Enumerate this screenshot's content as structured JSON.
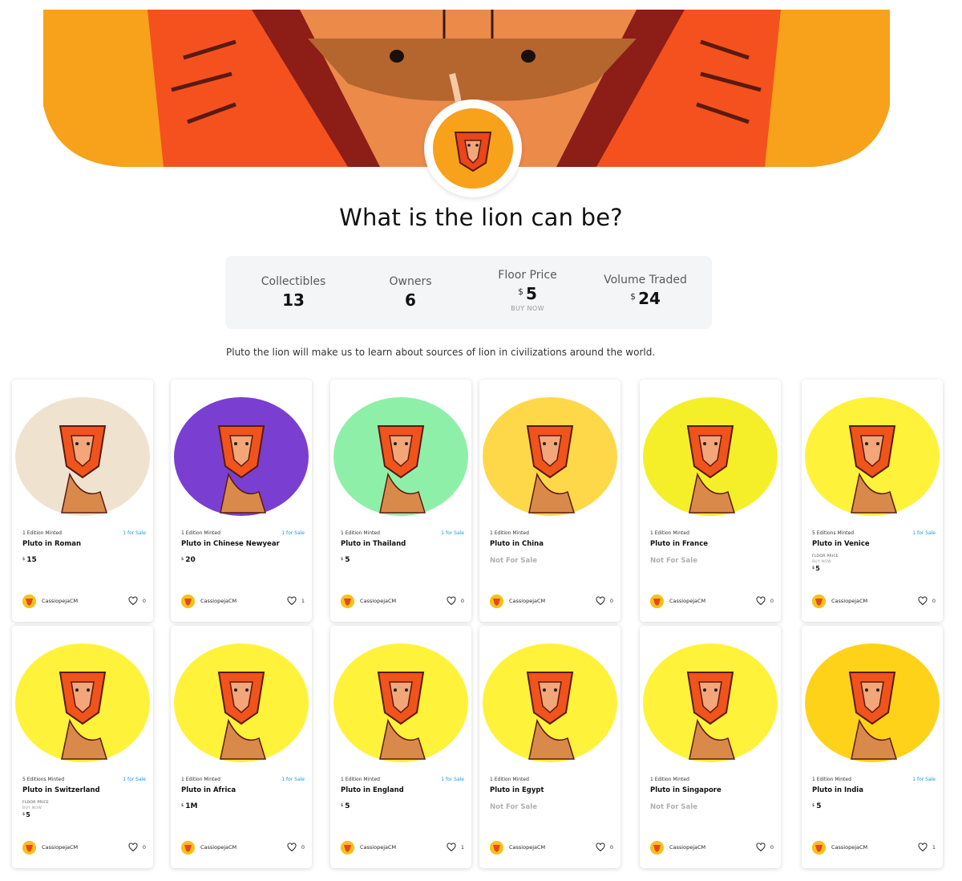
{
  "title": "What is the lion can be?",
  "stats": {
    "collectibles_label": "Collectibles",
    "collectibles_value": "13",
    "owners_label": "Owners",
    "owners_value": "6",
    "floor_label": "Floor Price",
    "floor_currency": "$",
    "floor_value": "5",
    "floor_action": "BUY NOW",
    "volume_label": "Volume Traded",
    "volume_currency": "$",
    "volume_value": "24"
  },
  "description": "Pluto the lion will make us to learn about sources of lion in civilizations around the world.",
  "cards": [
    {
      "editions": "1 Edition Minted",
      "sale": "1 for Sale",
      "name": "Pluto in Roman",
      "currency": "$",
      "price": "15",
      "status": "",
      "owner": "CassiopejaCM",
      "likes": "0",
      "art_bg": "#efe3d0"
    },
    {
      "editions": "1 Edition Minted",
      "sale": "1 for Sale",
      "name": "Pluto in Chinese Newyear",
      "currency": "$",
      "price": "20",
      "status": "",
      "owner": "CassiopejaCM",
      "likes": "1",
      "art_bg": "#7a3fd1"
    },
    {
      "editions": "1 Edition Minted",
      "sale": "1 for Sale",
      "name": "Pluto in Thailand",
      "currency": "$",
      "price": "5",
      "status": "",
      "owner": "CassiopejaCM",
      "likes": "0",
      "art_bg": "#8ef0a8"
    },
    {
      "editions": "1 Edition Minted",
      "sale": "",
      "name": "Pluto in China",
      "currency": "",
      "price": "",
      "status": "Not For Sale",
      "owner": "CassiopejaCM",
      "likes": "0",
      "art_bg": "#ffd84a"
    },
    {
      "editions": "1 Edition Minted",
      "sale": "",
      "name": "Pluto in France",
      "currency": "",
      "price": "",
      "status": "Not For Sale",
      "owner": "CassiopejaCM",
      "likes": "0",
      "art_bg": "#f5ef2a"
    },
    {
      "editions": "5 Editions Minted",
      "sale": "1 for Sale",
      "name": "Pluto in Venice",
      "currency": "$",
      "price": "5",
      "status": "",
      "floor_label": "FLOOR PRICE",
      "floor_action": "BUY NOW",
      "owner": "CassiopejaCM",
      "likes": "0",
      "art_bg": "#fff23a"
    },
    {
      "editions": "5 Editions Minted",
      "sale": "1 for Sale",
      "name": "Pluto in Switzerland",
      "currency": "$",
      "price": "5",
      "status": "",
      "floor_label": "FLOOR PRICE",
      "floor_action": "BUY NOW",
      "owner": "CassiopejaCM",
      "likes": "0",
      "art_bg": "#fff23a"
    },
    {
      "editions": "1 Edition Minted",
      "sale": "1 for Sale",
      "name": "Pluto in Africa",
      "currency": "$",
      "price": "1M",
      "status": "",
      "owner": "CassiopejaCM",
      "likes": "0",
      "art_bg": "#fff23a"
    },
    {
      "editions": "1 Edition Minted",
      "sale": "1 for Sale",
      "name": "Pluto in England",
      "currency": "$",
      "price": "5",
      "status": "",
      "owner": "CassiopejaCM",
      "likes": "1",
      "art_bg": "#fff23a"
    },
    {
      "editions": "1 Edition Minted",
      "sale": "",
      "name": "Pluto in Egypt",
      "currency": "",
      "price": "",
      "status": "Not For Sale",
      "owner": "CassiopejaCM",
      "likes": "0",
      "art_bg": "#fff23a"
    },
    {
      "editions": "1 Edition Minted",
      "sale": "",
      "name": "Pluto in Singapore",
      "currency": "",
      "price": "",
      "status": "Not For Sale",
      "owner": "CassiopejaCM",
      "likes": "0",
      "art_bg": "#fff23a"
    },
    {
      "editions": "1 Edition Minted",
      "sale": "1 for Sale",
      "name": "Pluto in India",
      "currency": "$",
      "price": "5",
      "status": "",
      "owner": "CassiopejaCM",
      "likes": "1",
      "art_bg": "#ffd21a"
    }
  ],
  "colors": {
    "banner_orange": "#f7a21a",
    "banner_red": "#f4511e",
    "lion_mane": "#f0541c",
    "accent_blue": "#1a9ae0"
  },
  "icons": {
    "heart": "heart-icon",
    "avatar": "lion-avatar-icon"
  }
}
